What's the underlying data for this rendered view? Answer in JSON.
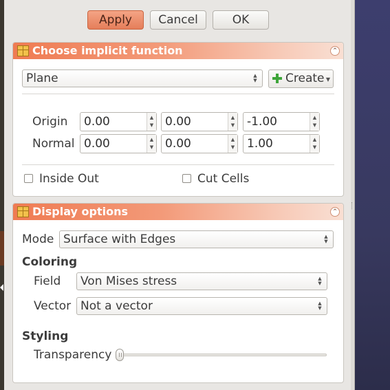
{
  "buttons": {
    "apply": "Apply",
    "cancel": "Cancel",
    "ok": "OK"
  },
  "implicit_function": {
    "title": "Choose implicit function",
    "function_type": "Plane",
    "create_label": "Create",
    "origin_label": "Origin",
    "normal_label": "Normal",
    "origin": [
      "0.00",
      "0.00",
      "-1.00"
    ],
    "normal": [
      "0.00",
      "0.00",
      "1.00"
    ],
    "inside_out_label": "Inside Out",
    "inside_out_checked": false,
    "cut_cells_label": "Cut Cells",
    "cut_cells_checked": false
  },
  "display_options": {
    "title": "Display options",
    "mode_label": "Mode",
    "mode_value": "Surface with Edges",
    "coloring_heading": "Coloring",
    "field_label": "Field",
    "field_value": "Von Mises stress",
    "vector_label": "Vector",
    "vector_value": "Not a vector",
    "styling_heading": "Styling",
    "transparency_label": "Transparency",
    "transparency_value": 0
  },
  "colors": {
    "accent": "#ef7b52",
    "apply_button": "#e9865f",
    "create_icon": "#3ea53a",
    "background_right": "#3d3e6e"
  },
  "icons": {
    "group_icon": "box-grid-icon",
    "collapse": "collapse-up-icon",
    "create": "plus-icon"
  }
}
